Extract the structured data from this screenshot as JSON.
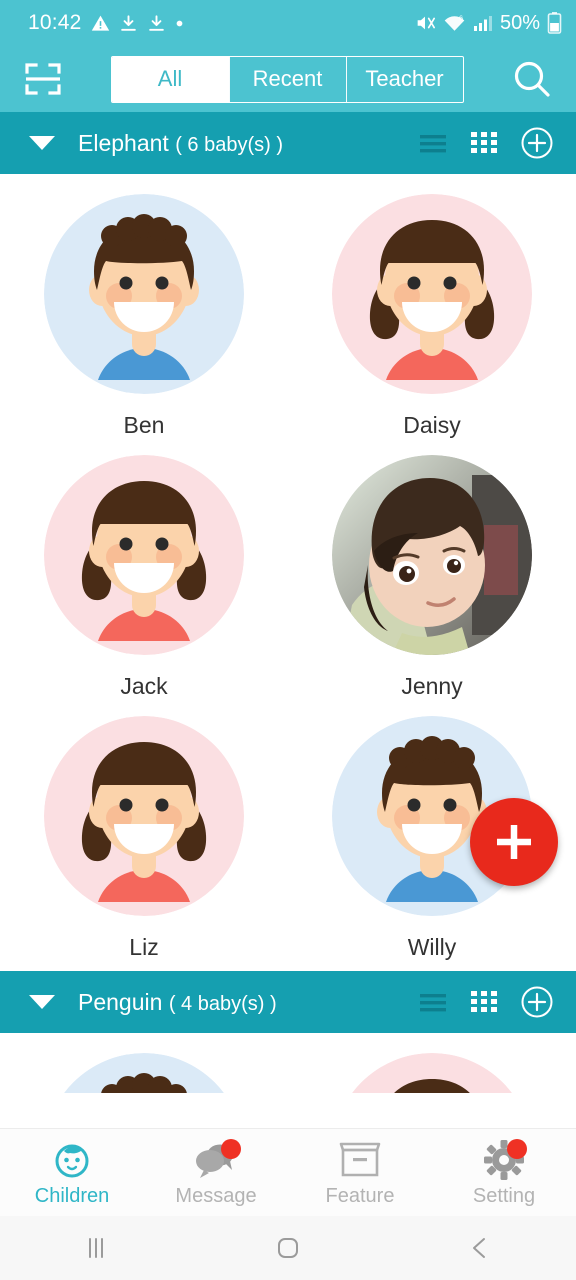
{
  "statusbar": {
    "time": "10:42",
    "battery_percent": "50%",
    "icons": [
      "warning-triangle-icon",
      "download-icon",
      "download-icon",
      "dot-icon",
      "mute-icon",
      "wifi-icon",
      "signal-icon",
      "battery-icon"
    ]
  },
  "appbar": {
    "scan_icon": "scan-qr-icon",
    "search_icon": "search-icon",
    "tabs": [
      {
        "label": "All",
        "active": true
      },
      {
        "label": "Recent",
        "active": false
      },
      {
        "label": "Teacher",
        "active": false
      }
    ]
  },
  "groups": [
    {
      "name": "Elephant",
      "count_label": "( 6 baby(s) )",
      "expanded": true,
      "children": [
        {
          "name": "Ben",
          "type": "boy"
        },
        {
          "name": "Daisy",
          "type": "girl"
        },
        {
          "name": "Jack",
          "type": "girl"
        },
        {
          "name": "Jenny",
          "type": "photo"
        },
        {
          "name": "Liz",
          "type": "girl"
        },
        {
          "name": "Willy",
          "type": "boy"
        }
      ]
    },
    {
      "name": "Penguin",
      "count_label": "( 4 baby(s) )",
      "expanded": true,
      "children": [
        {
          "name": "",
          "type": "boy"
        },
        {
          "name": "",
          "type": "girl"
        }
      ]
    }
  ],
  "fab": {
    "icon": "plus-icon"
  },
  "group_actions": {
    "list_icon": "list-view-icon",
    "grid_icon": "grid-view-icon",
    "add_icon": "add-circle-icon"
  },
  "bottom_nav": [
    {
      "label": "Children",
      "icon": "baby-face-icon",
      "active": true,
      "badge": false
    },
    {
      "label": "Message",
      "icon": "chat-bubbles-icon",
      "active": false,
      "badge": true
    },
    {
      "label": "Feature",
      "icon": "archive-box-icon",
      "active": false,
      "badge": false
    },
    {
      "label": "Setting",
      "icon": "gear-icon",
      "active": false,
      "badge": true
    }
  ],
  "system_nav": [
    {
      "icon": "recents-icon"
    },
    {
      "icon": "home-icon"
    },
    {
      "icon": "back-icon"
    }
  ],
  "colors": {
    "appbar_teal": "#4cc3d0",
    "group_teal": "#159fb0",
    "accent_red": "#e8291c",
    "active_nav": "#2fb6c7",
    "boy_bg": "#dbeaf7",
    "girl_bg": "#fbdfe2",
    "hair_brown": "#4a2c16",
    "skin": "#fbd3ab",
    "shirt_blue": "#4a98d4",
    "shirt_coral": "#f4675c"
  }
}
